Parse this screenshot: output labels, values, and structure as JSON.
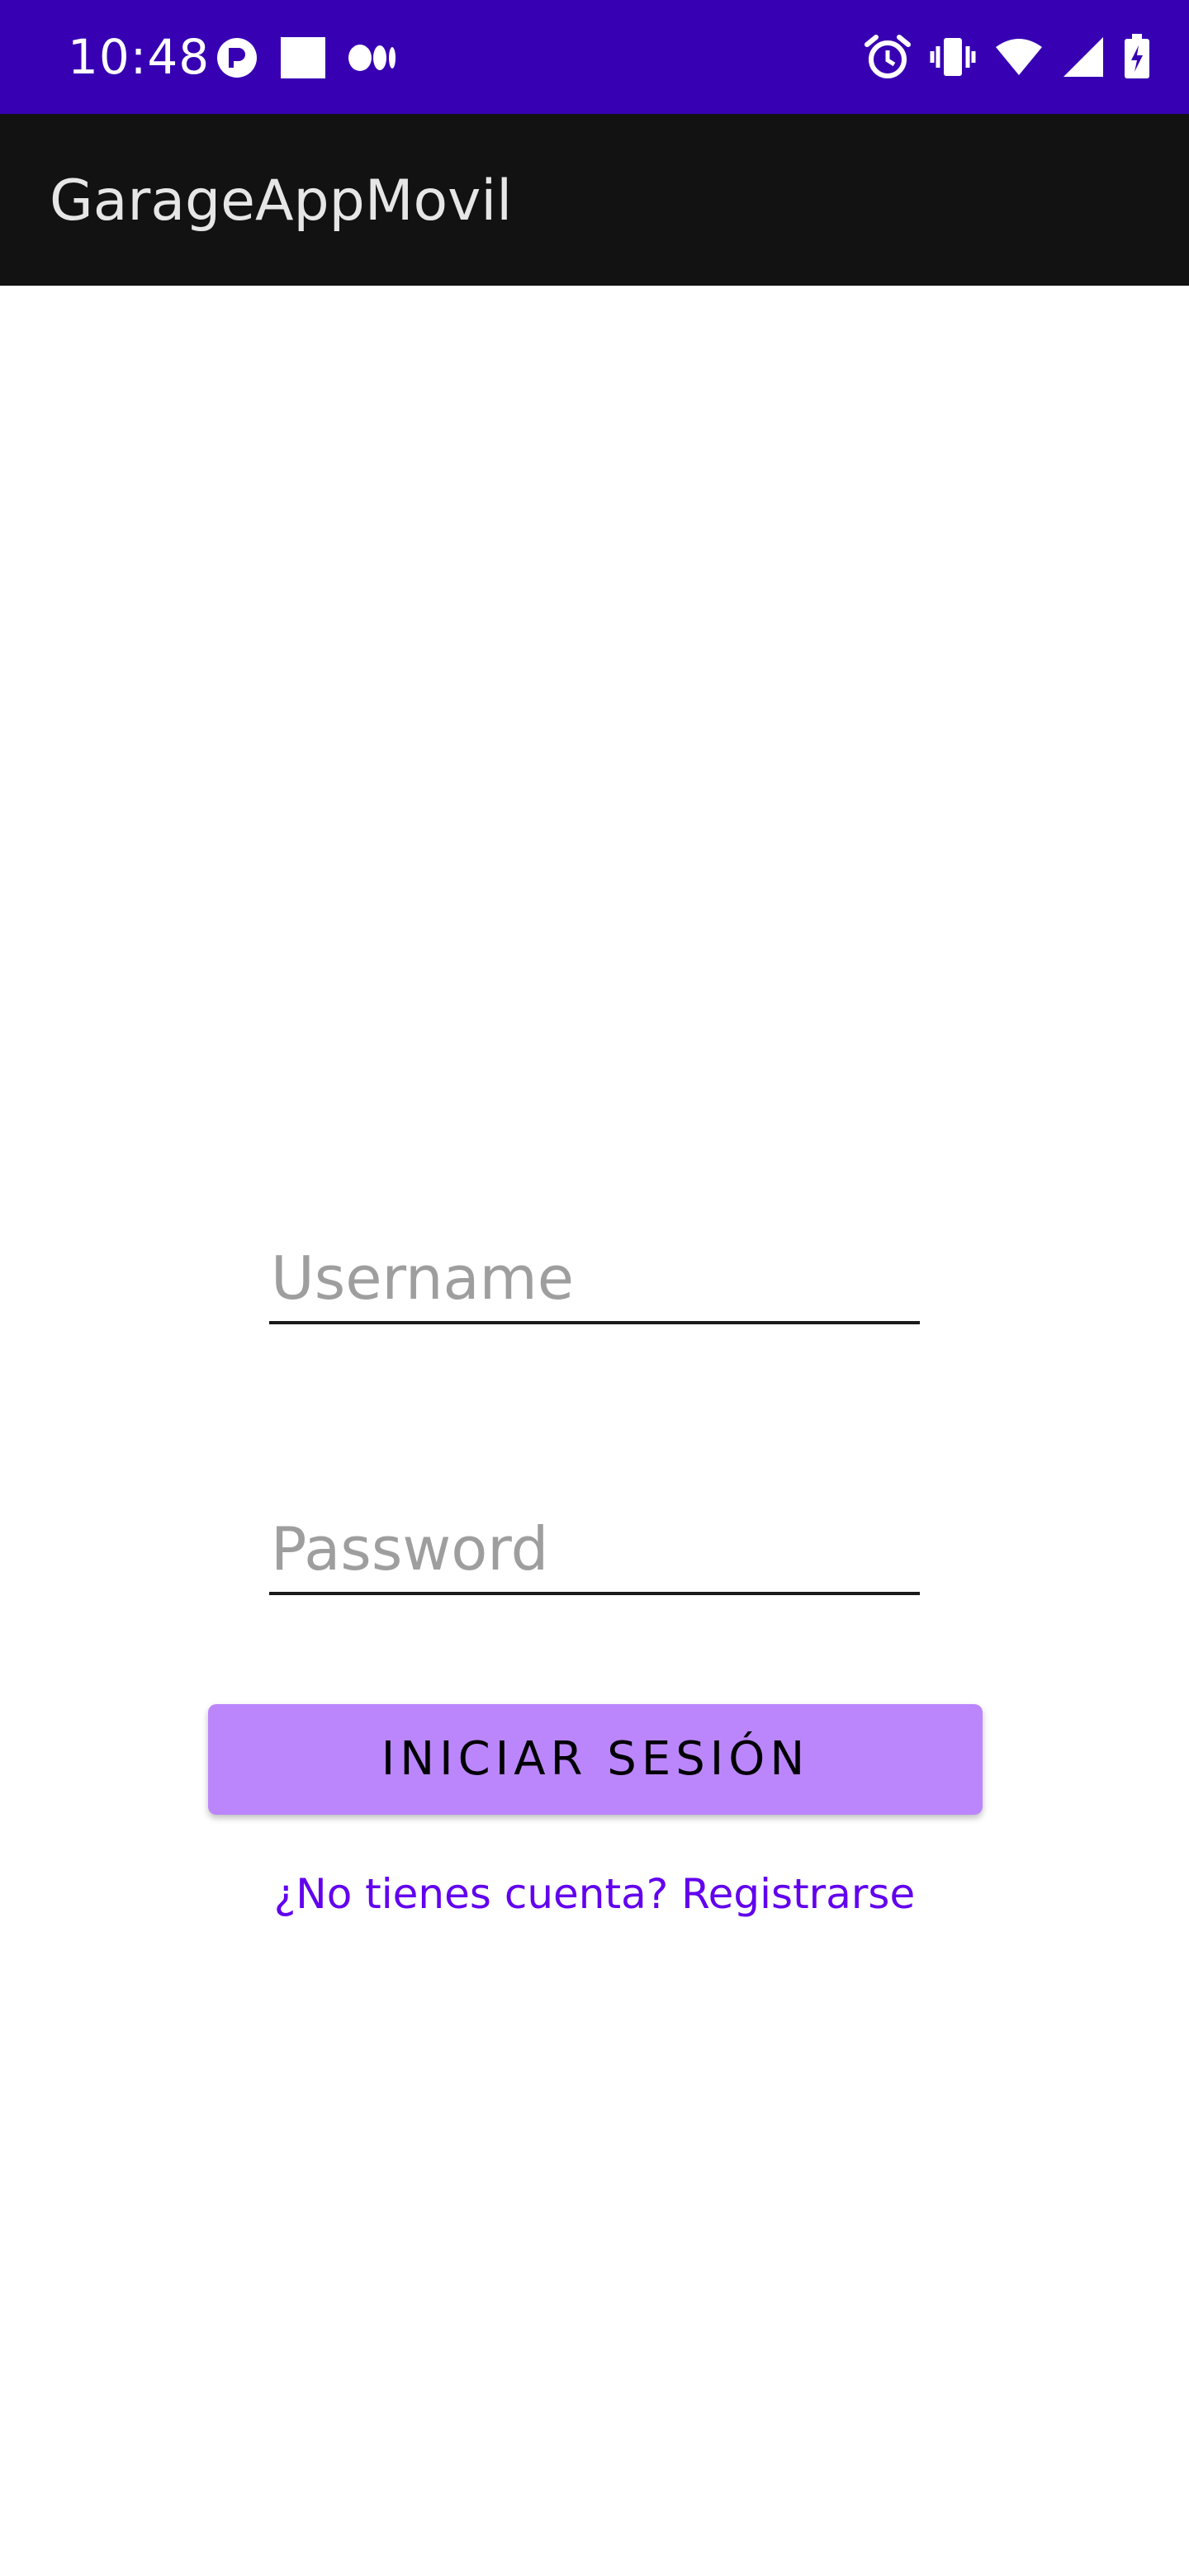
{
  "status_bar": {
    "time": "10:48",
    "background_color": "#3700b3",
    "left_icons": [
      "notification-p-icon",
      "square-notification-icon",
      "medium-app-icon"
    ],
    "right_icons": [
      "alarm-icon",
      "vibrate-icon",
      "wifi-icon",
      "cellular-signal-icon",
      "battery-charging-icon"
    ]
  },
  "app_bar": {
    "title": "GarageAppMovil",
    "background_color": "#121212"
  },
  "login_form": {
    "username_placeholder": "Username",
    "username_value": "",
    "password_placeholder": "Password",
    "password_value": "",
    "login_button_label": "INICIAR SESIÓN",
    "login_button_color": "#bb86fc",
    "register_link_text": "¿No tienes cuenta? Registrarse",
    "register_link_color": "#6200ee"
  }
}
